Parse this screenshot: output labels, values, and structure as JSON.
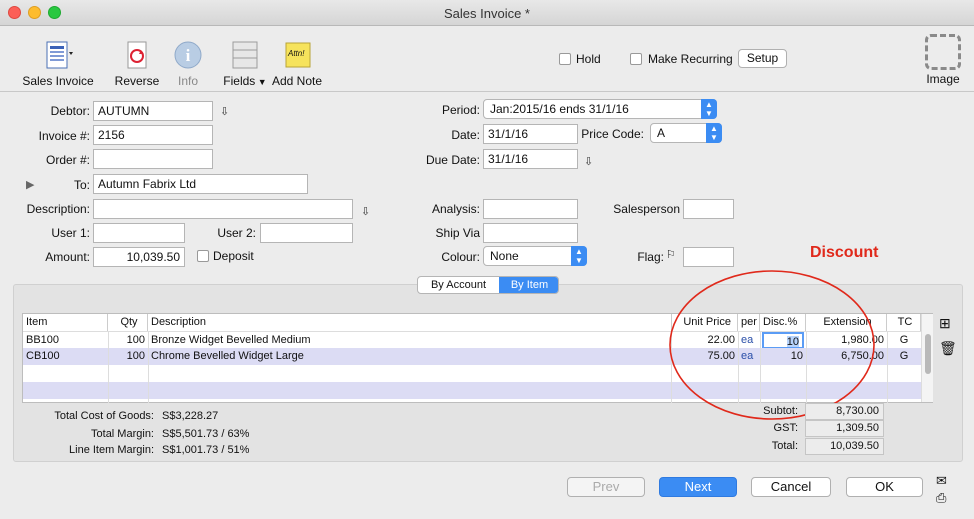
{
  "window": {
    "title": "Sales Invoice *"
  },
  "toolbar": {
    "sales_invoice": "Sales Invoice",
    "reverse": "Reverse",
    "info": "Info",
    "fields": "Fields",
    "add_note": "Add Note",
    "add_note_icon_text": "Attn!",
    "hold": "Hold",
    "make_recurring": "Make Recurring",
    "setup": "Setup",
    "image": "Image"
  },
  "form": {
    "debtor_label": "Debtor:",
    "debtor": "AUTUMN",
    "invoice_label": "Invoice #:",
    "invoice": "2156",
    "order_label": "Order #:",
    "order": "",
    "to_label": "To:",
    "to": "Autumn Fabrix Ltd",
    "description_label": "Description:",
    "description": "",
    "user1_label": "User 1:",
    "user1": "",
    "user2_label": "User 2:",
    "user2": "",
    "amount_label": "Amount:",
    "amount": "10,039.50",
    "deposit": "Deposit",
    "period_label": "Period:",
    "period": "Jan:2015/16 ends 31/1/16",
    "date_label": "Date:",
    "date": "31/1/16",
    "price_code_label": "Price Code:",
    "price_code": "A",
    "due_date_label": "Due Date:",
    "due_date": "31/1/16",
    "analysis_label": "Analysis:",
    "analysis": "",
    "salesperson_label": "Salesperson",
    "salesperson": "",
    "ship_via_label": "Ship Via",
    "ship_via": "",
    "colour_label": "Colour:",
    "colour": "None",
    "flag_label": "Flag:",
    "flag": ""
  },
  "annotation": {
    "discount": "Discount"
  },
  "tabs": {
    "by_account": "By Account",
    "by_item": "By Item"
  },
  "grid": {
    "headers": [
      "Item",
      "Qty",
      "Description",
      "Unit Price",
      "per",
      "Disc.%",
      "Extension",
      "TC"
    ],
    "rows": [
      {
        "item": "BB100",
        "qty": "100",
        "description": "Bronze Widget Bevelled Medium",
        "unit_price": "22.00",
        "per": "ea",
        "disc": "10",
        "extension": "1,980.00",
        "tc": "G"
      },
      {
        "item": "CB100",
        "qty": "100",
        "description": "Chrome Bevelled Widget Large",
        "unit_price": "75.00",
        "per": "ea",
        "disc": "10",
        "extension": "6,750.00",
        "tc": "G"
      }
    ]
  },
  "totals": {
    "cost_label": "Total Cost of Goods:",
    "cost": "S$3,228.27",
    "margin_label": "Total Margin:",
    "margin": "S$5,501.73 / 63%",
    "line_margin_label": "Line Item Margin:",
    "line_margin": "S$1,001.73 / 51%",
    "subtot_label": "Subtot:",
    "subtot": "8,730.00",
    "gst_label": "GST:",
    "gst": "1,309.50",
    "total_label": "Total:",
    "total": "10,039.50"
  },
  "buttons": {
    "prev": "Prev",
    "next": "Next",
    "cancel": "Cancel",
    "ok": "OK"
  },
  "colors": {
    "accent": "#3b8cf3",
    "annotation": "#e0291b",
    "selected_row": "#dcdcf4"
  }
}
